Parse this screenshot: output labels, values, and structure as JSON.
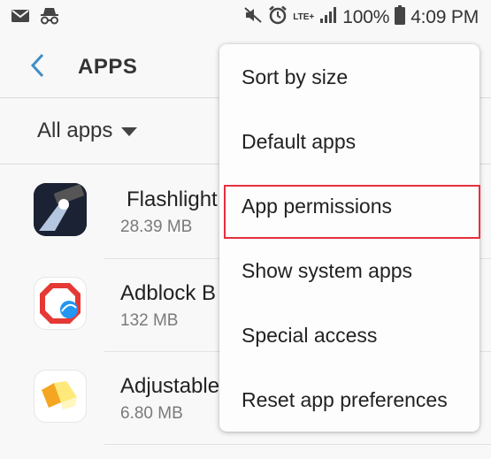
{
  "status_bar": {
    "left_icons": [
      "mail-icon",
      "incognito-icon"
    ],
    "right_icons": [
      "mute-icon",
      "alarm-icon",
      "lte-icon",
      "signal-icon",
      "battery-icon"
    ],
    "lte_label": "LTE+",
    "battery": "100%",
    "time": "4:09 PM"
  },
  "app_bar": {
    "title": "APPS",
    "back_icon": "chevron-left-icon"
  },
  "filter": {
    "label": "All apps",
    "icon": "dropdown-caret-icon"
  },
  "apps": [
    {
      "name": "Flashlight",
      "size": "28.39 MB",
      "icon": "flashlight-app-icon"
    },
    {
      "name": "Adblock B",
      "size": "132 MB",
      "icon": "adblock-app-icon"
    },
    {
      "name": "Adjustable",
      "size": "6.80 MB",
      "icon": "adjustable-app-icon"
    }
  ],
  "menu": {
    "items": [
      {
        "label": "Sort by size"
      },
      {
        "label": "Default apps"
      },
      {
        "label": "App permissions"
      },
      {
        "label": "Show system apps"
      },
      {
        "label": "Special access"
      },
      {
        "label": "Reset app preferences"
      }
    ],
    "highlighted_index": 2,
    "highlight_color": "#e5303e"
  },
  "colors": {
    "accent": "#3d8ec4",
    "background": "#f8f8f8"
  }
}
